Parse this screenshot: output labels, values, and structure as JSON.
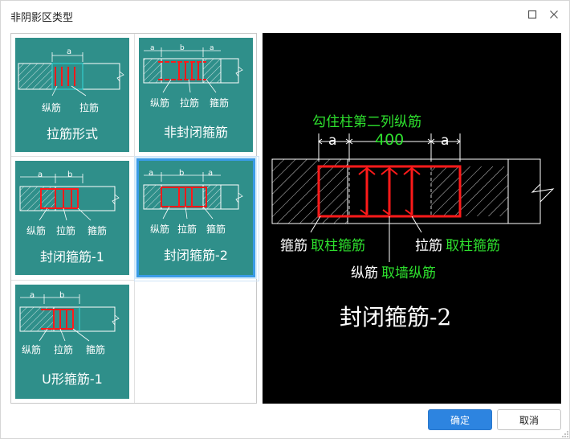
{
  "window": {
    "title": "非阴影区类型"
  },
  "colors": {
    "card_bg": "#2f8f8a",
    "selection": "#3a9be6",
    "rebar": "#ff1a1a",
    "annotation_green": "#2ee02e",
    "primary_button": "#2d84e0"
  },
  "options": [
    {
      "title": "拉筋形式",
      "dims": [
        "a"
      ],
      "labels": [
        "纵筋",
        "拉筋"
      ]
    },
    {
      "title": "非封闭箍筋",
      "dims": [
        "a",
        "b",
        "a"
      ],
      "labels": [
        "纵筋",
        "拉筋",
        "箍筋"
      ]
    },
    {
      "title": "封闭箍筋-1",
      "dims": [
        "a",
        "b"
      ],
      "labels": [
        "纵筋",
        "拉筋",
        "箍筋"
      ]
    },
    {
      "title": "封闭箍筋-2",
      "dims": [
        "a",
        "b",
        "a"
      ],
      "labels": [
        "纵筋",
        "拉筋",
        "箍筋"
      ]
    },
    {
      "title": "U形箍筋-1",
      "dims": [
        "a",
        "b"
      ],
      "labels": [
        "纵筋",
        "拉筋",
        "箍筋"
      ]
    }
  ],
  "selected_index": 3,
  "preview": {
    "top_label": "勾住柱第二列纵筋",
    "dim_a_left": "a",
    "dim_middle": "400",
    "dim_a_right": "a",
    "stirrup_label": "箍筋",
    "stirrup_source": "取柱箍筋",
    "tie_label": "拉筋",
    "tie_source": "取柱箍筋",
    "longitudinal_label": "纵筋",
    "longitudinal_source": "取墙纵筋",
    "caption": "封闭箍筋-2"
  },
  "buttons": {
    "ok": "确定",
    "cancel": "取消"
  }
}
